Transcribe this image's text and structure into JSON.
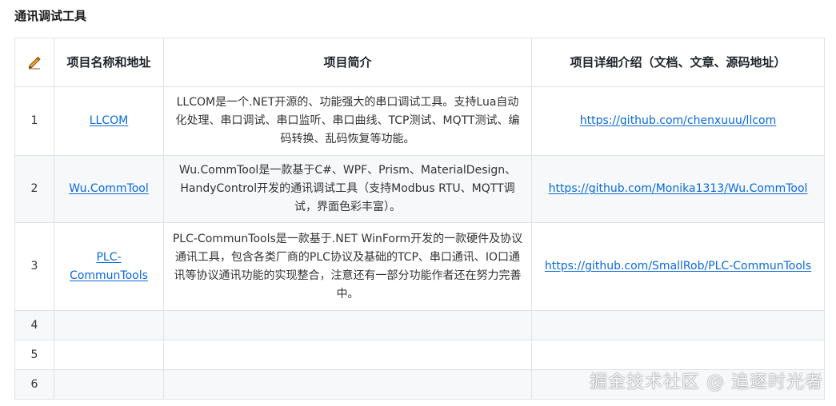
{
  "section_title": "通讯调试工具",
  "table": {
    "header": {
      "icon": "pencil-icon",
      "name": "项目名称和地址",
      "intro": "项目简介",
      "detail": "项目详细介绍（文档、文章、源码地址）"
    },
    "rows": [
      {
        "index": "1",
        "name": "LLCOM",
        "intro": "LLCOM是一个.NET开源的、功能强大的串口调试工具。支持Lua自动化处理、串口调试、串口监听、串口曲线、TCP测试、MQTT测试、编码转换、乱码恢复等功能。",
        "link": "https://github.com/chenxuuu/llcom"
      },
      {
        "index": "2",
        "name": "Wu.CommTool",
        "intro": "Wu.CommTool是一款基于C#、WPF、Prism、MaterialDesign、HandyControl开发的通讯调试工具（支持Modbus RTU、MQTT调试，界面色彩丰富）。",
        "link": "https://github.com/Monika1313/Wu.CommTool"
      },
      {
        "index": "3",
        "name": "PLC-CommunTools",
        "intro": "PLC-CommunTools是一款基于.NET WinForm开发的一款硬件及协议通讯工具，包含各类厂商的PLC协议及基础的TCP、串口通讯、IO口通讯等协议通讯功能的实现整合，注意还有一部分功能作者还在努力完善中。",
        "link": "https://github.com/SmallRob/PLC-CommunTools"
      },
      {
        "index": "4",
        "name": "",
        "intro": "",
        "link": ""
      },
      {
        "index": "5",
        "name": "",
        "intro": "",
        "link": ""
      },
      {
        "index": "6",
        "name": "",
        "intro": "",
        "link": ""
      }
    ]
  },
  "watermark": "掘金技术社区 @ 追逐时光者",
  "colors": {
    "link": "#0969da",
    "border": "#dfe2e5",
    "stripe": "#f6f8fa",
    "pencil": "#f0a030"
  }
}
